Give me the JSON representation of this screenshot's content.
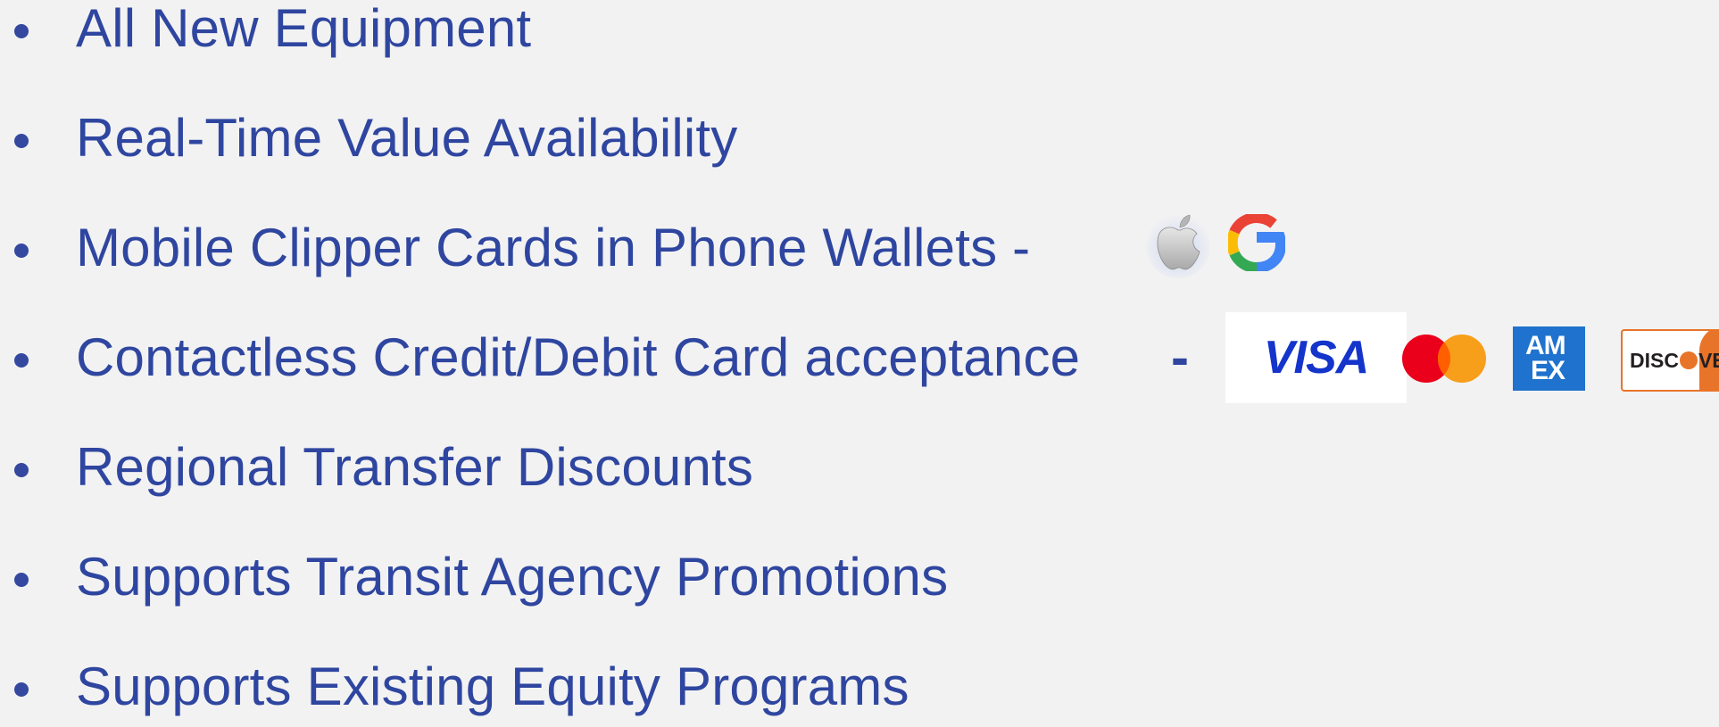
{
  "bullets": [
    {
      "text": "All New Equipment"
    },
    {
      "text": "Real-Time Value Availability"
    },
    {
      "text": "Mobile Clipper Cards in Phone Wallets -"
    },
    {
      "text": "Contactless Credit/Debit Card acceptance",
      "dash": "-"
    },
    {
      "text": "Regional Transfer Discounts"
    },
    {
      "text": "Supports Transit Agency Promotions"
    },
    {
      "text": "Supports Existing Equity Programs"
    }
  ],
  "logos": {
    "wallets": [
      "apple-logo",
      "google-logo"
    ],
    "cards": {
      "visa": "VISA",
      "mastercard": "mastercard-logo",
      "amex_line1": "AM",
      "amex_line2": "EX",
      "discover_prefix": "DISC",
      "discover_suffix": "VER"
    }
  },
  "colors": {
    "text": "#2f46a0",
    "background": "#f2f2f2",
    "visa_blue": "#1434cb",
    "mastercard_red": "#eb001b",
    "mastercard_orange": "#f79e1b",
    "amex_blue": "#1f72cd",
    "discover_orange": "#e8742a"
  }
}
